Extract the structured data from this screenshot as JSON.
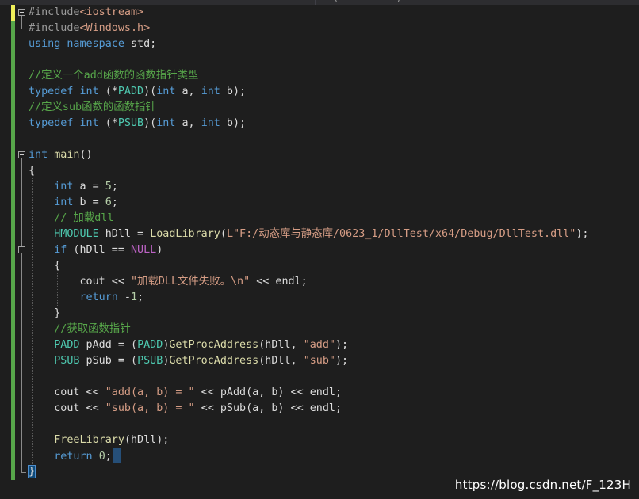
{
  "tab_fragment": "(          )",
  "colors": {
    "keyword": "#569cd6",
    "type": "#4ec9b0",
    "string": "#d69d85",
    "comment": "#57a64a",
    "preprocessor": "#9b9b9b",
    "header": "#d69d85",
    "macro": "#bd63c5",
    "function": "#dcdcaa",
    "number": "#b5cea8",
    "plain": "#dcdcdc"
  },
  "code_lines": [
    [
      [
        "preprocessor",
        "#include"
      ],
      [
        "header",
        "<iostream>"
      ]
    ],
    [
      [
        "preprocessor",
        "#include"
      ],
      [
        "header",
        "<Windows.h>"
      ]
    ],
    [
      [
        "keyword",
        "using"
      ],
      [
        "plain",
        " "
      ],
      [
        "keyword",
        "namespace"
      ],
      [
        "plain",
        " std;"
      ]
    ],
    [],
    [
      [
        "comment",
        "//定义一个add函数的函数指针类型"
      ]
    ],
    [
      [
        "keyword",
        "typedef"
      ],
      [
        "plain",
        " "
      ],
      [
        "keyword",
        "int"
      ],
      [
        "plain",
        " (*"
      ],
      [
        "type",
        "PADD"
      ],
      [
        "plain",
        ")("
      ],
      [
        "keyword",
        "int"
      ],
      [
        "plain",
        " a, "
      ],
      [
        "keyword",
        "int"
      ],
      [
        "plain",
        " b);"
      ]
    ],
    [
      [
        "comment",
        "//定义sub函数的函数指针"
      ]
    ],
    [
      [
        "keyword",
        "typedef"
      ],
      [
        "plain",
        " "
      ],
      [
        "keyword",
        "int"
      ],
      [
        "plain",
        " (*"
      ],
      [
        "type",
        "PSUB"
      ],
      [
        "plain",
        ")("
      ],
      [
        "keyword",
        "int"
      ],
      [
        "plain",
        " a, "
      ],
      [
        "keyword",
        "int"
      ],
      [
        "plain",
        " b);"
      ]
    ],
    [],
    [
      [
        "keyword",
        "int"
      ],
      [
        "plain",
        " "
      ],
      [
        "function",
        "main"
      ],
      [
        "plain",
        "()"
      ]
    ],
    [
      [
        "plain",
        "{"
      ]
    ],
    [
      [
        "plain",
        "    "
      ],
      [
        "keyword",
        "int"
      ],
      [
        "plain",
        " a = "
      ],
      [
        "number",
        "5"
      ],
      [
        "plain",
        ";"
      ]
    ],
    [
      [
        "plain",
        "    "
      ],
      [
        "keyword",
        "int"
      ],
      [
        "plain",
        " b = "
      ],
      [
        "number",
        "6"
      ],
      [
        "plain",
        ";"
      ]
    ],
    [
      [
        "plain",
        "    "
      ],
      [
        "comment",
        "// 加载dll"
      ]
    ],
    [
      [
        "plain",
        "    "
      ],
      [
        "type",
        "HMODULE"
      ],
      [
        "plain",
        " hDll = "
      ],
      [
        "function",
        "LoadLibrary"
      ],
      [
        "plain",
        "("
      ],
      [
        "string",
        "L\"F:/动态库与静态库/0623_1/DllTest/x64/Debug/DllTest.dll\""
      ],
      [
        "plain",
        ");"
      ]
    ],
    [
      [
        "plain",
        "    "
      ],
      [
        "keyword",
        "if"
      ],
      [
        "plain",
        " (hDll == "
      ],
      [
        "macro",
        "NULL"
      ],
      [
        "plain",
        ")"
      ]
    ],
    [
      [
        "plain",
        "    {"
      ]
    ],
    [
      [
        "plain",
        "        cout << "
      ],
      [
        "string",
        "\"加载DLL文件失败。\\n\""
      ],
      [
        "plain",
        " << endl;"
      ]
    ],
    [
      [
        "plain",
        "        "
      ],
      [
        "keyword",
        "return"
      ],
      [
        "plain",
        " -"
      ],
      [
        "number",
        "1"
      ],
      [
        "plain",
        ";"
      ]
    ],
    [
      [
        "plain",
        "    }"
      ]
    ],
    [
      [
        "plain",
        "    "
      ],
      [
        "comment",
        "//获取函数指针"
      ]
    ],
    [
      [
        "plain",
        "    "
      ],
      [
        "type",
        "PADD"
      ],
      [
        "plain",
        " pAdd = ("
      ],
      [
        "type",
        "PADD"
      ],
      [
        "plain",
        ")"
      ],
      [
        "function",
        "GetProcAddress"
      ],
      [
        "plain",
        "(hDll, "
      ],
      [
        "string",
        "\"add\""
      ],
      [
        "plain",
        ");"
      ]
    ],
    [
      [
        "plain",
        "    "
      ],
      [
        "type",
        "PSUB"
      ],
      [
        "plain",
        " pSub = ("
      ],
      [
        "type",
        "PSUB"
      ],
      [
        "plain",
        ")"
      ],
      [
        "function",
        "GetProcAddress"
      ],
      [
        "plain",
        "(hDll, "
      ],
      [
        "string",
        "\"sub\""
      ],
      [
        "plain",
        ");"
      ]
    ],
    [],
    [
      [
        "plain",
        "    cout << "
      ],
      [
        "string",
        "\"add(a, b) = \""
      ],
      [
        "plain",
        " << pAdd(a, b) << endl;"
      ]
    ],
    [
      [
        "plain",
        "    cout << "
      ],
      [
        "string",
        "\"sub(a, b) = \""
      ],
      [
        "plain",
        " << pSub(a, b) << endl;"
      ]
    ],
    [],
    [
      [
        "plain",
        "    "
      ],
      [
        "function",
        "FreeLibrary"
      ],
      [
        "plain",
        "(hDll);"
      ]
    ],
    [
      [
        "plain",
        "    "
      ],
      [
        "keyword",
        "return"
      ],
      [
        "plain",
        " "
      ],
      [
        "number",
        "0"
      ],
      [
        "plain",
        ";"
      ]
    ],
    [
      [
        "plain",
        "}"
      ]
    ]
  ],
  "watermark": "https://blog.csdn.net/F_123H"
}
